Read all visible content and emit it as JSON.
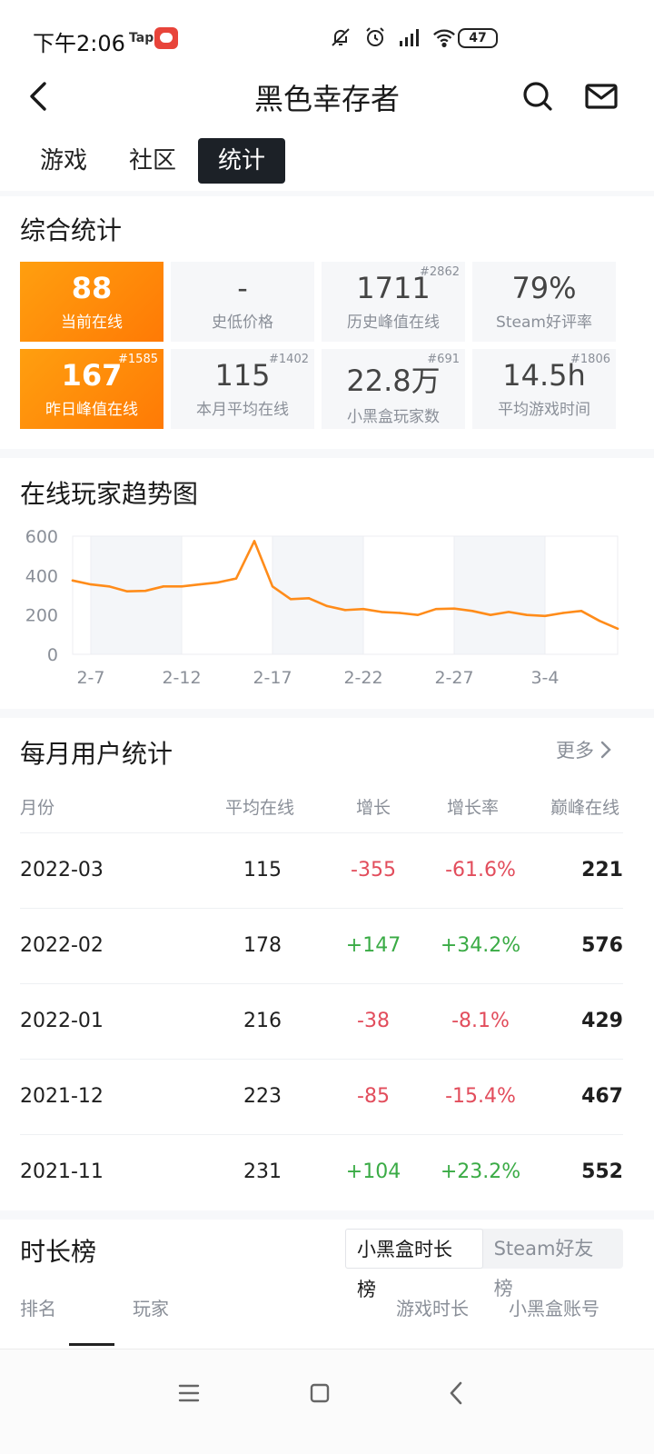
{
  "status_bar": {
    "time": "下午2:06",
    "tap_badge": "Tap",
    "battery": "47"
  },
  "header": {
    "title": "黑色幸存者"
  },
  "tabs": [
    {
      "label": "游戏",
      "active": false
    },
    {
      "label": "社区",
      "active": false
    },
    {
      "label": "统计",
      "active": true
    }
  ],
  "overview": {
    "title": "综合统计",
    "stats": [
      {
        "value": "88",
        "label": "当前在线",
        "rank": "",
        "highlight": true
      },
      {
        "value": "-",
        "label": "史低价格",
        "rank": "",
        "highlight": false
      },
      {
        "value": "1711",
        "label": "历史峰值在线",
        "rank": "#2862",
        "highlight": false
      },
      {
        "value": "79%",
        "label": "Steam好评率",
        "rank": "",
        "highlight": false
      },
      {
        "value": "167",
        "label": "昨日峰值在线",
        "rank": "#1585",
        "highlight": true
      },
      {
        "value": "115",
        "label": "本月平均在线",
        "rank": "#1402",
        "highlight": false
      },
      {
        "value": "22.8万",
        "label": "小黑盒玩家数",
        "rank": "#691",
        "highlight": false
      },
      {
        "value": "14.5h",
        "label": "平均游戏时间",
        "rank": "#1806",
        "highlight": false
      }
    ]
  },
  "trend": {
    "title": "在线玩家趋势图",
    "chart_data": {
      "type": "line",
      "x": [
        "2-6",
        "2-7",
        "2-8",
        "2-9",
        "2-10",
        "2-11",
        "2-12",
        "2-13",
        "2-14",
        "2-15",
        "2-16",
        "2-17",
        "2-18",
        "2-19",
        "2-20",
        "2-21",
        "2-22",
        "2-23",
        "2-24",
        "2-25",
        "2-26",
        "2-27",
        "2-28",
        "3-1",
        "3-2",
        "3-3",
        "3-4",
        "3-5",
        "3-6",
        "3-7",
        "3-8"
      ],
      "tick_labels": [
        "2-7",
        "2-12",
        "2-17",
        "2-22",
        "2-27",
        "3-4"
      ],
      "series": [
        {
          "values": [
            375,
            355,
            345,
            320,
            322,
            345,
            345,
            355,
            365,
            385,
            575,
            345,
            280,
            285,
            245,
            225,
            230,
            215,
            210,
            200,
            230,
            232,
            220,
            200,
            215,
            200,
            195,
            210,
            220,
            170,
            130
          ],
          "color": "#ff8c1a"
        }
      ],
      "y_ticks": [
        "600",
        "400",
        "200",
        "0"
      ],
      "ylim": [
        0,
        600
      ],
      "grid": true
    }
  },
  "monthly": {
    "title": "每月用户统计",
    "more_label": "更多",
    "headers": {
      "month": "月份",
      "avg": "平均在线",
      "growth": "增长",
      "rate": "增长率",
      "peak": "巅峰在线"
    },
    "rows": [
      {
        "month": "2022-03",
        "avg": "115",
        "growth": "-355",
        "rate": "-61.6%",
        "peak": "221",
        "trend": "neg"
      },
      {
        "month": "2022-02",
        "avg": "178",
        "growth": "+147",
        "rate": "+34.2%",
        "peak": "576",
        "trend": "pos"
      },
      {
        "month": "2022-01",
        "avg": "216",
        "growth": "-38",
        "rate": "-8.1%",
        "peak": "429",
        "trend": "neg"
      },
      {
        "month": "2021-12",
        "avg": "223",
        "growth": "-85",
        "rate": "-15.4%",
        "peak": "467",
        "trend": "neg"
      },
      {
        "month": "2021-11",
        "avg": "231",
        "growth": "+104",
        "rate": "+23.2%",
        "peak": "552",
        "trend": "pos"
      }
    ]
  },
  "ranking": {
    "title": "时长榜",
    "toggle": [
      "小黑盒时长榜",
      "Steam好友榜"
    ],
    "headers": {
      "rank": "排名",
      "player": "玩家",
      "playtime": "游戏时长",
      "account": "小黑盒账号"
    }
  },
  "icons": {
    "back": "back-arrow-icon",
    "search": "search-icon",
    "mail": "mail-icon",
    "mute": "bell-off-icon",
    "alarm": "alarm-icon",
    "signal": "signal-icon",
    "wifi": "wifi-icon",
    "menu": "menu-icon",
    "home": "home-icon",
    "nav_back": "nav-back-icon",
    "more": "chevron-right-icon"
  },
  "colors": {
    "accent_orange": "#ff8c1a",
    "tab_active_bg": "#1c2127",
    "negative": "#e24d5c",
    "positive": "#3aab45"
  }
}
